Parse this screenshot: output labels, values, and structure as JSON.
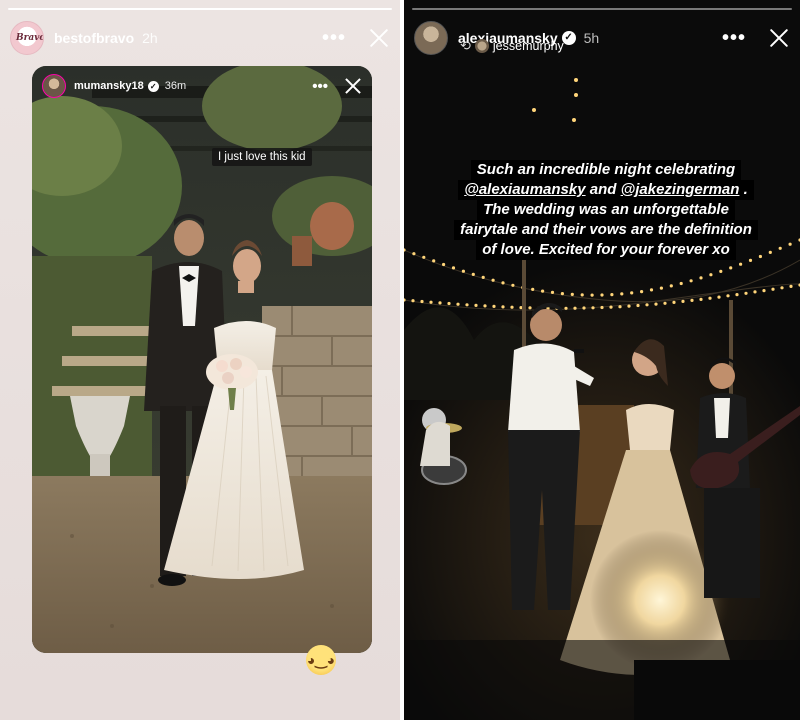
{
  "left_story": {
    "username": "bestofbravo",
    "timestamp": "2h",
    "avatar_text": "Bravo",
    "progress": 1.0,
    "menu_icon": "more-dots-icon",
    "close_icon": "close-icon",
    "inner_story": {
      "username": "mumansky18",
      "timestamp": "36m",
      "caption": "I just love this kid",
      "menu_icon": "more-dots-icon",
      "close_icon": "close-icon"
    },
    "emoji_sticker": "◕‿◕"
  },
  "right_story": {
    "username": "alexiaumansky",
    "timestamp": "5h",
    "verified": true,
    "collaborator": "jessemurphy",
    "progress": 0.0,
    "caption_lines": [
      [
        "Such an incredible night celebrating"
      ],
      [
        "@alexiaumansky",
        " and ",
        "@jakezingerman",
        " ."
      ],
      [
        "The wedding was an unforgettable"
      ],
      [
        "fairytale and their vows are the definition"
      ],
      [
        "of love. Excited for your forever xo"
      ]
    ],
    "caption": {
      "line1": "Such an incredible night celebrating",
      "mention1": "@alexiaumansky",
      "between": " and ",
      "mention2": "@jakezingerman",
      "line2_end": " .",
      "line3": "The wedding was an unforgettable",
      "line4": "fairytale and their vows are the definition",
      "line5": "of love. Excited for your forever xo"
    }
  },
  "colors": {
    "left_bg": "#e8dfdd",
    "right_bg": "#0d0d0d",
    "caption_bg": "#000000",
    "caption_text": "#ffffff",
    "string_lights": "#ffd57a"
  }
}
